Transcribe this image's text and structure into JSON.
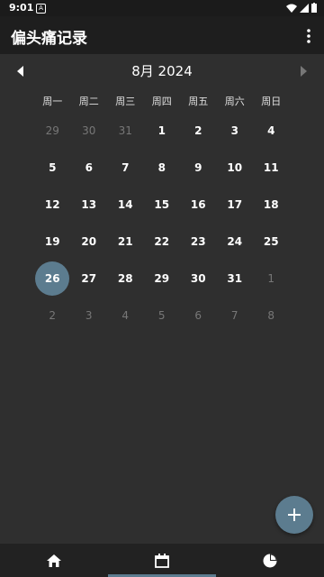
{
  "status": {
    "time": "9:01",
    "notification_glyph": "A"
  },
  "app": {
    "title": "偏头痛记录"
  },
  "calendar": {
    "month_label": "8月 2024",
    "weekdays": [
      "周一",
      "周二",
      "周三",
      "周四",
      "周五",
      "周六",
      "周日"
    ],
    "days": [
      {
        "label": "29",
        "muted": true
      },
      {
        "label": "30",
        "muted": true
      },
      {
        "label": "31",
        "muted": true
      },
      {
        "label": "1",
        "muted": false
      },
      {
        "label": "2",
        "muted": false
      },
      {
        "label": "3",
        "muted": false
      },
      {
        "label": "4",
        "muted": false
      },
      {
        "label": "5",
        "muted": false
      },
      {
        "label": "6",
        "muted": false
      },
      {
        "label": "7",
        "muted": false
      },
      {
        "label": "8",
        "muted": false
      },
      {
        "label": "9",
        "muted": false
      },
      {
        "label": "10",
        "muted": false
      },
      {
        "label": "11",
        "muted": false
      },
      {
        "label": "12",
        "muted": false
      },
      {
        "label": "13",
        "muted": false
      },
      {
        "label": "14",
        "muted": false
      },
      {
        "label": "15",
        "muted": false
      },
      {
        "label": "16",
        "muted": false
      },
      {
        "label": "17",
        "muted": false
      },
      {
        "label": "18",
        "muted": false
      },
      {
        "label": "19",
        "muted": false
      },
      {
        "label": "20",
        "muted": false
      },
      {
        "label": "21",
        "muted": false
      },
      {
        "label": "22",
        "muted": false
      },
      {
        "label": "23",
        "muted": false
      },
      {
        "label": "24",
        "muted": false
      },
      {
        "label": "25",
        "muted": false
      },
      {
        "label": "26",
        "muted": false,
        "selected": true
      },
      {
        "label": "27",
        "muted": false
      },
      {
        "label": "28",
        "muted": false
      },
      {
        "label": "29",
        "muted": false
      },
      {
        "label": "30",
        "muted": false
      },
      {
        "label": "31",
        "muted": false
      },
      {
        "label": "1",
        "muted": true
      },
      {
        "label": "2",
        "muted": true
      },
      {
        "label": "3",
        "muted": true
      },
      {
        "label": "4",
        "muted": true
      },
      {
        "label": "5",
        "muted": true
      },
      {
        "label": "6",
        "muted": true
      },
      {
        "label": "7",
        "muted": true
      },
      {
        "label": "8",
        "muted": true
      }
    ]
  },
  "fab": {
    "icon": "add-icon"
  },
  "bottom_nav": {
    "items": [
      {
        "icon": "home-icon",
        "active": false
      },
      {
        "icon": "calendar-icon",
        "active": true
      },
      {
        "icon": "pie-chart-icon",
        "active": false
      }
    ]
  },
  "colors": {
    "accent": "#5c7c8f",
    "background": "#2f2f2f",
    "app_bar": "#1e1e1e"
  }
}
